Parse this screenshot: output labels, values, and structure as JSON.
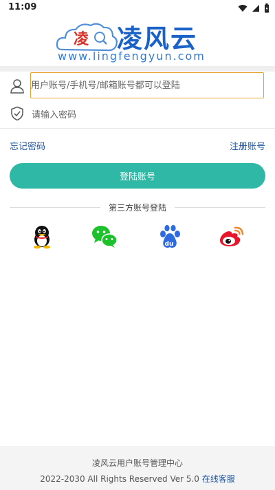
{
  "status_bar": {
    "time": "11:09"
  },
  "header": {
    "logo_text": "凌风云",
    "logo_url_text": "www.lingfengyun.com",
    "logo_badge": "凌"
  },
  "form": {
    "username_placeholder": "用户账号/手机号/邮箱账号都可以登陆",
    "password_placeholder": "请输入密码",
    "forgot_link": "忘记密码",
    "register_link": "注册账号",
    "login_button": "登陆账号"
  },
  "third_party": {
    "heading": "第三方账号登陆",
    "providers": [
      {
        "name": "QQ",
        "icon": "qq-icon"
      },
      {
        "name": "WeChat",
        "icon": "wechat-icon"
      },
      {
        "name": "Baidu",
        "icon": "baidu-icon"
      },
      {
        "name": "Weibo",
        "icon": "weibo-icon"
      }
    ]
  },
  "footer": {
    "title": "凌风云用户账号管理中心",
    "copyright": "2022-2030 All Rights Reserved Ver 5.0",
    "service_link": "在线客服"
  },
  "colors": {
    "accent": "#2fb8a5",
    "link": "#1e56a0",
    "brand_blue": "#1a62c8",
    "input_focus_border": "#e6a02c"
  }
}
